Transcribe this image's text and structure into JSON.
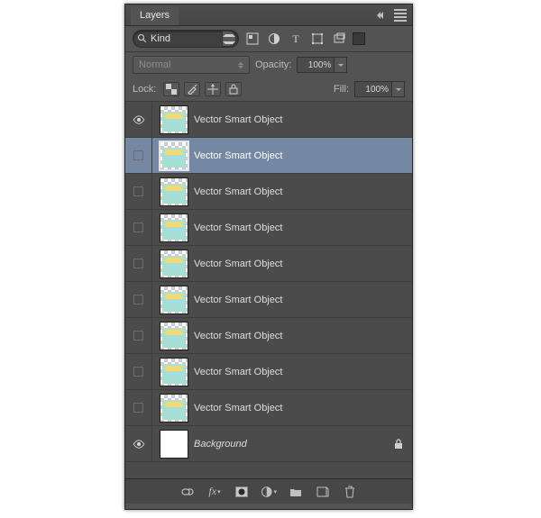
{
  "panel": {
    "title": "Layers"
  },
  "filter": {
    "search_value": "Kind"
  },
  "blend": {
    "mode": "Normal",
    "opacity_label": "Opacity:",
    "opacity_value": "100%",
    "fill_label": "Fill:",
    "fill_value": "100%",
    "lock_label": "Lock:"
  },
  "layers": [
    {
      "name": "Vector Smart Object",
      "visible": true,
      "selected": false,
      "thumb": "art",
      "locked": false
    },
    {
      "name": "Vector Smart Object",
      "visible": false,
      "selected": true,
      "thumb": "art",
      "locked": false
    },
    {
      "name": "Vector Smart Object",
      "visible": false,
      "selected": false,
      "thumb": "art",
      "locked": false
    },
    {
      "name": "Vector Smart Object",
      "visible": false,
      "selected": false,
      "thumb": "art",
      "locked": false
    },
    {
      "name": "Vector Smart Object",
      "visible": false,
      "selected": false,
      "thumb": "art",
      "locked": false
    },
    {
      "name": "Vector Smart Object",
      "visible": false,
      "selected": false,
      "thumb": "art",
      "locked": false
    },
    {
      "name": "Vector Smart Object",
      "visible": false,
      "selected": false,
      "thumb": "art",
      "locked": false
    },
    {
      "name": "Vector Smart Object",
      "visible": false,
      "selected": false,
      "thumb": "art",
      "locked": false
    },
    {
      "name": "Vector Smart Object",
      "visible": false,
      "selected": false,
      "thumb": "art",
      "locked": false
    },
    {
      "name": "Background",
      "visible": true,
      "selected": false,
      "thumb": "white",
      "locked": true
    }
  ]
}
